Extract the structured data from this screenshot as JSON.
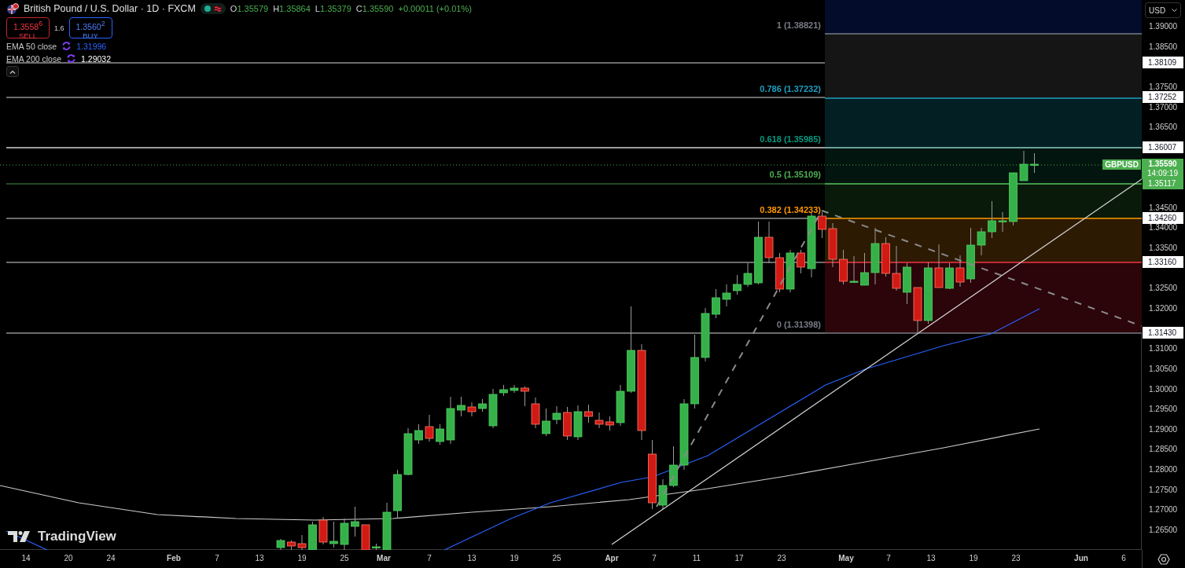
{
  "header": {
    "title": "British Pound / U.S. Dollar · 1D · FXCM",
    "ohlc": [
      {
        "label": "O",
        "value": "1.35579"
      },
      {
        "label": "H",
        "value": "1.35864"
      },
      {
        "label": "L",
        "value": "1.35379"
      },
      {
        "label": "C",
        "value": "1.35590"
      }
    ],
    "change": "+0.00011 (+0.01%)"
  },
  "trade": {
    "sell": {
      "price": "1.3558$^{6}$",
      "label": "SELL"
    },
    "spread": "1.6",
    "buy": {
      "price": "1.3560$^{2}$",
      "label": "BUY"
    }
  },
  "indicators": [
    {
      "name": "EMA 50 close",
      "value": "1.31996",
      "color": "#2962ff"
    },
    {
      "name": "EMA 200 close",
      "value": "1.29032",
      "color": "#ffffff"
    }
  ],
  "fib_levels": [
    {
      "label": "1 (1.38821)",
      "color": "#787b86"
    },
    {
      "label": "0.786 (1.37232)",
      "color": "#1e9fc0"
    },
    {
      "label": "0.618 (1.35985)",
      "color": "#089981"
    },
    {
      "label": "0.5 (1.35109)",
      "color": "#4caf50"
    },
    {
      "label": "0.382 (1.34233)",
      "color": "#ff9800"
    },
    {
      "label": "0 (1.31398)",
      "color": "#787b86"
    }
  ],
  "price_axis": {
    "currency": "USD",
    "ticks": [
      "1.39000",
      "1.38500",
      "1.37500",
      "1.37000",
      "1.36500",
      "1.34500",
      "1.34000",
      "1.33500",
      "1.32500",
      "1.32000",
      "1.31000",
      "1.30500",
      "1.30000",
      "1.29500",
      "1.29000",
      "1.28500",
      "1.28000",
      "1.27500",
      "1.27000",
      "1.26500"
    ],
    "tags": [
      {
        "value": "1.38109",
        "color": "#ffffff"
      },
      {
        "value": "1.37252",
        "color": "#ffffff"
      },
      {
        "value": "1.36007",
        "color": "#ffffff"
      },
      {
        "value": "1.35117",
        "color": "#4caf50"
      },
      {
        "value": "1.34260",
        "color": "#ffffff"
      },
      {
        "value": "1.33160",
        "color": "#ffffff"
      },
      {
        "value": "1.31430",
        "color": "#ffffff"
      }
    ],
    "last": {
      "symbol": "GBPUSD",
      "price": "1.35590",
      "countdown": "14:09:19"
    }
  },
  "time_axis": [
    {
      "label": "14",
      "kind": "day"
    },
    {
      "label": "20",
      "kind": "day"
    },
    {
      "label": "24",
      "kind": "day"
    },
    {
      "label": "Feb",
      "kind": "month"
    },
    {
      "label": "7",
      "kind": "day"
    },
    {
      "label": "13",
      "kind": "day"
    },
    {
      "label": "19",
      "kind": "day"
    },
    {
      "label": "25",
      "kind": "day"
    },
    {
      "label": "Mar",
      "kind": "month"
    },
    {
      "label": "7",
      "kind": "day"
    },
    {
      "label": "13",
      "kind": "day"
    },
    {
      "label": "19",
      "kind": "day"
    },
    {
      "label": "25",
      "kind": "day"
    },
    {
      "label": "Apr",
      "kind": "month"
    },
    {
      "label": "7",
      "kind": "day"
    },
    {
      "label": "11",
      "kind": "day"
    },
    {
      "label": "17",
      "kind": "day"
    },
    {
      "label": "23",
      "kind": "day"
    },
    {
      "label": "May",
      "kind": "month"
    },
    {
      "label": "7",
      "kind": "day"
    },
    {
      "label": "13",
      "kind": "day"
    },
    {
      "label": "19",
      "kind": "day"
    },
    {
      "label": "23",
      "kind": "day"
    },
    {
      "label": "Jun",
      "kind": "month"
    },
    {
      "label": "6",
      "kind": "day"
    }
  ],
  "logo": "TradingView"
}
